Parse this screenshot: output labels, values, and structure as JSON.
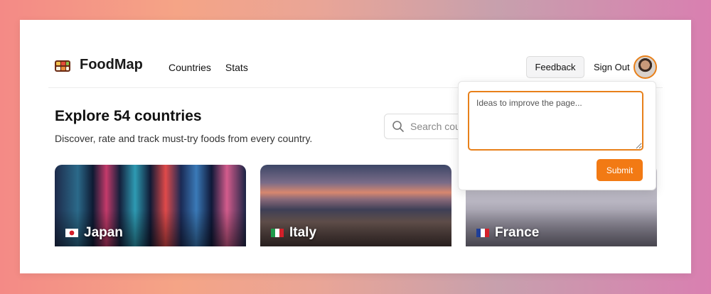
{
  "app": {
    "name": "FoodMap",
    "logo_icon": "bento-box-icon"
  },
  "nav": {
    "items": [
      {
        "label": "Countries"
      },
      {
        "label": "Stats"
      }
    ]
  },
  "header": {
    "feedback_label": "Feedback",
    "signout_label": "Sign Out"
  },
  "hero": {
    "title": "Explore 54 countries",
    "subtitle": "Discover, rate and track must-try foods from every country."
  },
  "search": {
    "placeholder": "Search countries..."
  },
  "cards": [
    {
      "name": "Japan",
      "flag": "japan-flag-icon"
    },
    {
      "name": "Italy",
      "flag": "italy-flag-icon"
    },
    {
      "name": "France",
      "flag": "france-flag-icon"
    }
  ],
  "feedback_popover": {
    "placeholder": "Ideas to improve the page...",
    "value": "",
    "submit_label": "Submit"
  },
  "colors": {
    "accent": "#f27a14",
    "text": "#111111"
  }
}
